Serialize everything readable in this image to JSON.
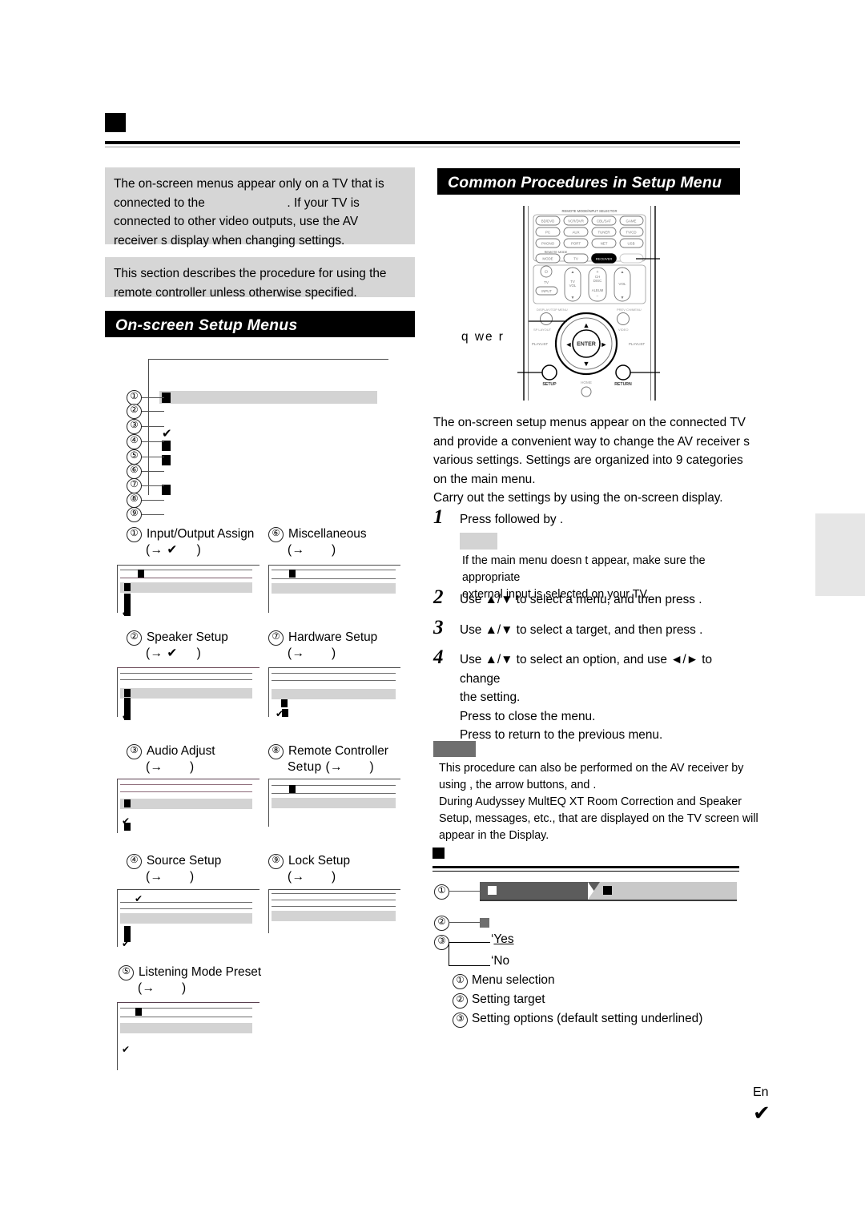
{
  "page": {
    "footer_language": "En",
    "footer_page_glyph": "✔"
  },
  "left_column": {
    "note_box_1": [
      "The on-screen menus appear only on a TV that is",
      "connected to the                        . If your TV is",
      "connected to other video outputs, use the AV",
      "receiver s display when changing settings."
    ],
    "note_box_2": [
      "This section describes the procedure for using the",
      "remote controller unless otherwise specified."
    ],
    "section_heading": "On-screen Setup Menus",
    "main_menu_numbers": [
      "①",
      "②",
      "③",
      "④",
      "⑤",
      "⑥",
      "⑦",
      "⑧",
      "⑨"
    ],
    "categories": [
      {
        "num": "①",
        "title": "Input/Output Assign",
        "ref_open": "(→",
        "ref_mark": "✔",
        "ref_close": ")"
      },
      {
        "num": "②",
        "title": "Speaker Setup",
        "ref_open": "(→",
        "ref_mark": "✔",
        "ref_close": ")"
      },
      {
        "num": "③",
        "title": "Audio Adjust",
        "ref_open": "(→",
        "ref_mark": "",
        "ref_close": ")"
      },
      {
        "num": "④",
        "title": "Source Setup",
        "ref_open": "(→",
        "ref_mark": "",
        "ref_close": ")"
      },
      {
        "num": "⑤",
        "title": "Listening Mode Preset",
        "ref_open": "(→",
        "ref_mark": "",
        "ref_close": ")"
      },
      {
        "num": "⑥",
        "title": "Miscellaneous",
        "ref_open": "(→",
        "ref_mark": "",
        "ref_close": ")"
      },
      {
        "num": "⑦",
        "title": "Hardware Setup",
        "ref_open": "(→",
        "ref_mark": "",
        "ref_close": ")"
      },
      {
        "num": "⑧",
        "title": "Remote Controller",
        "title2": "Setup (→",
        "ref_open": "",
        "ref_mark": "",
        "ref_close": ")"
      },
      {
        "num": "⑨",
        "title": "Lock Setup",
        "ref_open": "(→",
        "ref_mark": "",
        "ref_close": ")"
      }
    ]
  },
  "right_column": {
    "section_heading": "Common Procedures in Setup Menu",
    "callout_labels": "q we  r",
    "remote": {
      "mode_label": "REMOTE MODE",
      "top_label": "REMOTE MODE/INPUT SELECTOR",
      "input_buttons": [
        [
          "BD/DVD",
          "VCR/DVR",
          "CBL/SAT",
          "GAME"
        ],
        [
          "PC",
          "AUX",
          "TUNER",
          "TV/CD"
        ],
        [
          "PHONO",
          "PORT",
          "NET",
          "USB"
        ]
      ],
      "mode_buttons": [
        "MODE",
        "TV",
        "RECEIVER",
        ""
      ],
      "power_label": "TV",
      "input_btn": "INPUT",
      "tv_vol": "TV VOL",
      "ch_disc": "CH DISC",
      "album": "ALBUM",
      "vol": "VOL",
      "top_menu": "DISPLAY/TOP MENU",
      "prev_ch": "PREV CH/MENU",
      "sp_layout": "SP LAYOUT",
      "video": "VIDEO",
      "playlist_l": "PLAYLIST",
      "playlist_r": "PLAYLIST",
      "enter": "ENTER",
      "setup": "SETUP",
      "home": "HOME",
      "return": "RETURN"
    },
    "intro": [
      "The on-screen setup menus appear on the connected TV",
      "and provide a convenient way to change the AV receiver s",
      "various settings. Settings are organized into 9 categories",
      "on the main menu.",
      "Carry out the settings by using the on-screen display."
    ],
    "steps": [
      {
        "n": "1",
        "lines": [
          "Press                    followed by              ."
        ]
      },
      {
        "n": "2",
        "lines": [
          "Use ▲/▼ to select a menu, and then press            ."
        ]
      },
      {
        "n": "3",
        "lines": [
          "Use ▲/▼ to select a target, and then press           ."
        ]
      },
      {
        "n": "4",
        "lines": [
          "Use ▲/▼ to select an option, and use ◄/► to change",
          "the setting.",
          "Press               to close the menu.",
          "Press  to return to the previous menu."
        ]
      }
    ],
    "step1_tip": [
      "If the main menu doesn t appear, make sure the appropriate",
      "external input is selected on your TV."
    ],
    "note_block": [
      "This procedure can also be performed on the AV receiver by",
      "using            , the arrow buttons, and          .",
      "During Audyssey MultEQ XT Room Correction and Speaker",
      "Setup, messages, etc., that are displayed on the TV screen will",
      "appear in the Display."
    ],
    "sample_options": [
      "Yes",
      "No"
    ],
    "sample_option_bullets": [
      "‘",
      "‘"
    ],
    "legend": [
      {
        "num": "①",
        "text": "Menu selection"
      },
      {
        "num": "②",
        "text": "Setting target"
      },
      {
        "num": "③",
        "text": "Setting options (default setting underlined)"
      }
    ],
    "sample_numbers": [
      "①",
      "②",
      "③"
    ]
  }
}
